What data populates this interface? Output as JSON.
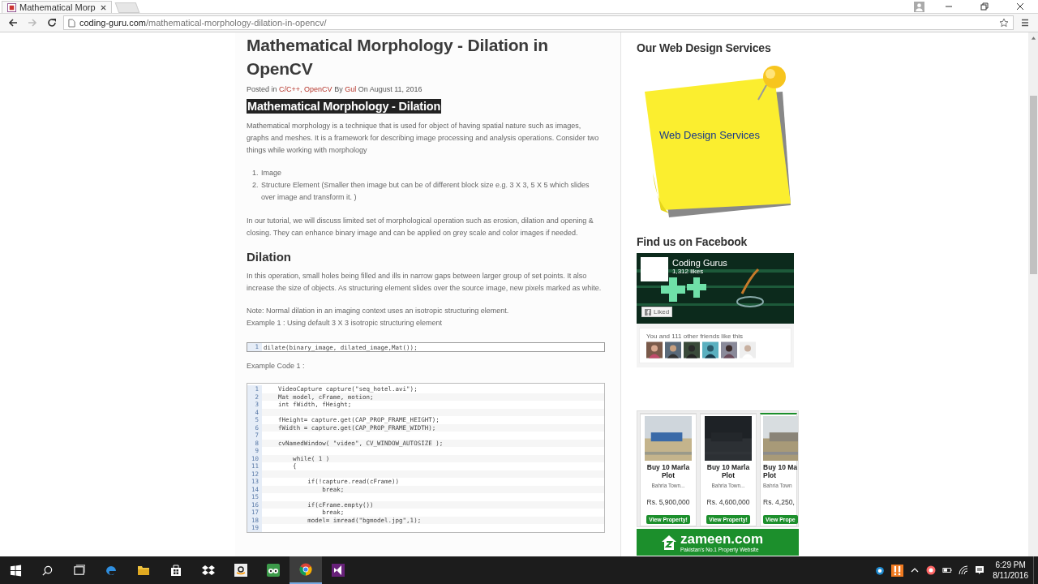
{
  "browser": {
    "tab_title": "Mathematical Morp",
    "url_domain": "coding-guru.com",
    "url_path": "/mathematical-morphology-dilation-in-opencv/"
  },
  "article": {
    "title": "Mathematical Morphology - Dilation in OpenCV",
    "meta": [
      {
        "kind": "text",
        "text": "Posted in"
      },
      {
        "kind": "link",
        "text": "C/C++,"
      },
      {
        "kind": "link",
        "text": "OpenCV"
      },
      {
        "kind": "text",
        "text": "By"
      },
      {
        "kind": "link",
        "text": "Gul"
      },
      {
        "kind": "text",
        "text": "On August 11, 2016"
      }
    ],
    "highlight_heading": "Mathematical Morphology - Dilation",
    "intro": "Mathematical morphology is a technique that is used for object of having spatial nature such as images, graphs and meshes. It is a framework for describing image processing and analysis operations. Consider two things while working with morphology",
    "list": [
      {
        "number": "1.",
        "text": "Image"
      },
      {
        "number": "2.",
        "text": "Structure Element (Smaller then image but can be of different block size e.g. 3 X 3, 5 X 5 which slides over image and transform it. )"
      }
    ],
    "tutorial": "In our tutorial, we will discuss limited set of morphological operation such as erosion, dilation and opening & closing. They can enhance binary image and can be applied on grey scale and color images if needed.",
    "section_title": "Dilation",
    "section_text": "In this operation, small holes being filled and ills in narrow gaps between larger group of set points. It also increase the size of objects. As structuring element slides over the source image, new pixels marked as white.",
    "note": "Note: Normal dilation in an imaging context uses an isotropic structuring element.",
    "example": "Example 1 : Using default 3 X 3 isotropic structuring element",
    "code_short": [
      {
        "number": "1",
        "code": "dilate(binary_image, dilated_image,Mat());"
      }
    ],
    "example_code_label": "Example Code 1 :",
    "code_long": [
      {
        "number": "1",
        "code": "    VideoCapture capture(\"seq_hotel.avi\");"
      },
      {
        "number": "2",
        "code": "    Mat model, cFrame, motion;"
      },
      {
        "number": "3",
        "code": "    int fWidth, fHeight;"
      },
      {
        "number": "4"
      },
      {
        "number": "5",
        "code": "    fHeight= capture.get(CAP_PROP_FRAME_HEIGHT);"
      },
      {
        "number": "6",
        "code": "    fWidth = capture.get(CAP_PROP_FRAME_WIDTH);"
      },
      {
        "number": "7"
      },
      {
        "number": "8",
        "code": "    cvNamedWindow( \"video\", CV_WINDOW_AUTOSIZE );"
      },
      {
        "number": "9"
      },
      {
        "number": "10",
        "code": "        while( 1 )"
      },
      {
        "number": "11",
        "code": "        {"
      },
      {
        "number": "12"
      },
      {
        "number": "13",
        "code": "            if(!capture.read(cFrame))"
      },
      {
        "number": "14",
        "code": "                break;"
      },
      {
        "number": "15"
      },
      {
        "number": "16",
        "code": "            if(cFrame.empty())"
      },
      {
        "number": "17",
        "code": "                break;"
      },
      {
        "number": "18",
        "code": "            model= imread(\"bgmodel.jpg\",1);"
      },
      {
        "number": "19"
      }
    ]
  },
  "sidebar": {
    "services_title": "Our Web Design Services",
    "services_banner": "Web Design Services",
    "facebook_title": "Find us on Facebook",
    "facebook": {
      "page_name": "Coding Gurus",
      "likes": "1,312 likes",
      "like_button": "Liked",
      "liked": true,
      "friends_text": "You and 111 other friends like this"
    },
    "ads": [
      {
        "title": [
          "Buy 10 Marla",
          "Plot"
        ],
        "location": "Bahria Town...",
        "price": "Rs. 5,900,000",
        "button": "View Property!",
        "highlighted": false
      },
      {
        "title": [
          "Buy 10 Marla",
          "Plot"
        ],
        "location": "Bahria Town...",
        "price": "Rs. 4,600,000",
        "button": "View Property!",
        "highlighted": false
      },
      {
        "title": [
          "Buy 10 Ma",
          "Plot"
        ],
        "location": "Bahria Town",
        "price": "Rs. 4,250,",
        "button": "View Prope",
        "highlighted": true
      }
    ],
    "zameen": {
      "name": "zameen.com",
      "tagline": "Pakistan's No.1 Property Website"
    }
  },
  "taskbar": {
    "apps": [
      {
        "kind": "edge",
        "active": false
      },
      {
        "kind": "explorer",
        "active": false
      },
      {
        "kind": "store",
        "active": false
      },
      {
        "kind": "dropbox",
        "active": false
      },
      {
        "kind": "amazon",
        "active": false
      },
      {
        "kind": "tripadvisor",
        "active": false
      },
      {
        "kind": "chrome",
        "active": true
      },
      {
        "kind": "visualstudio",
        "active": false
      }
    ],
    "time": "6:29 PM",
    "date": "8/11/2016"
  }
}
